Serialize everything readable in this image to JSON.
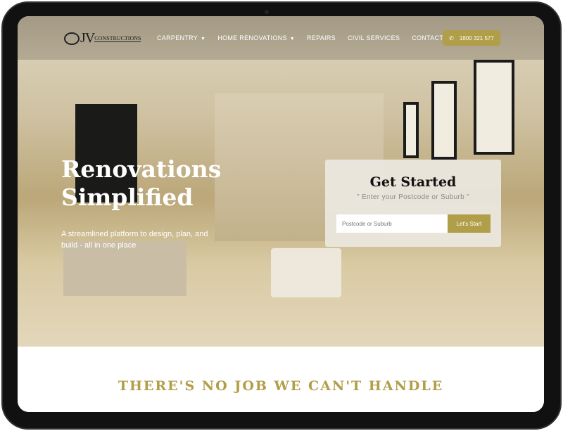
{
  "brand": {
    "logo_text": "JV CONSTRUCTIONS",
    "accent": "#b19e48"
  },
  "nav": {
    "items": [
      {
        "label": "CARPENTRY",
        "dropdown": true
      },
      {
        "label": "HOME RENOVATIONS",
        "dropdown": true
      },
      {
        "label": "REPAIRS"
      },
      {
        "label": "CIVIL SERVICES"
      },
      {
        "label": "CONTACT US"
      }
    ],
    "phone": "1800 321 577",
    "caret": "▼"
  },
  "hero": {
    "title_line1": "Renovations",
    "title_line2": "Simplified",
    "subtitle": "A streamlined platform to design, plan, and build - all in one place"
  },
  "card": {
    "title": "Get Started",
    "hint": "\" Enter your Postcode or Suburb \"",
    "placeholder": "Postcode or Suburb",
    "button": "Let's Start"
  },
  "section": {
    "heading": "THERE'S NO JOB WE CAN'T HANDLE"
  }
}
